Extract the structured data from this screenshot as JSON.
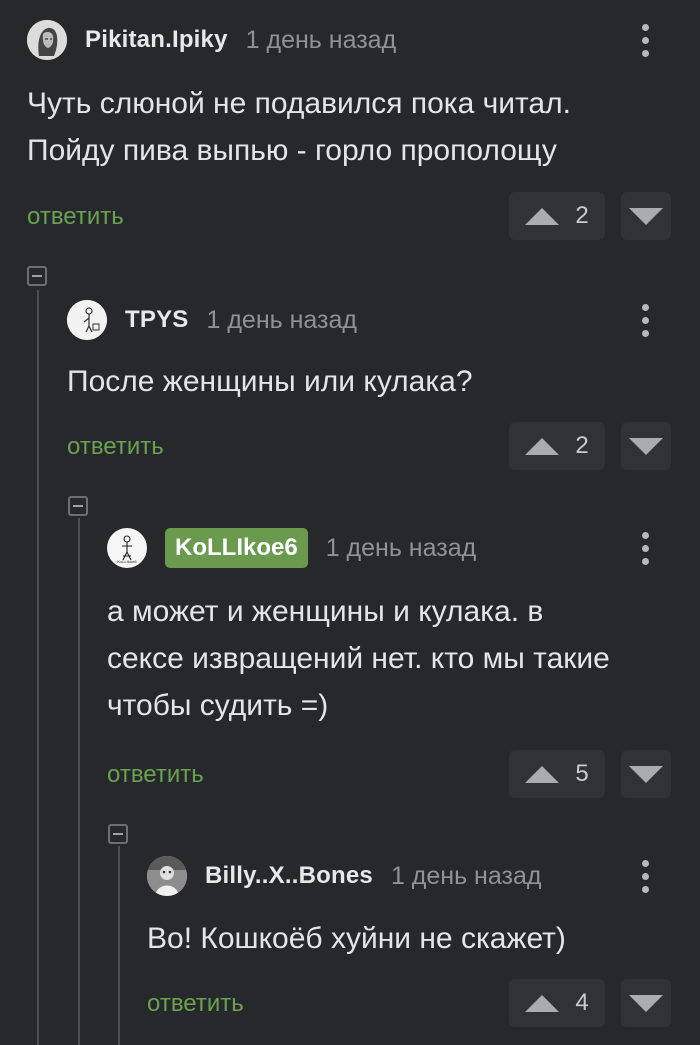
{
  "comments": [
    {
      "author": "Pikitan.Ipiky",
      "time": "1 день назад",
      "text": "Чуть слюной не подавился пока читал. Пойду пива выпью - горло прополощу",
      "reply_label": "ответить",
      "score": "2",
      "avatar_icon": "avatar-sketch-icon",
      "author_highlighted": false
    },
    {
      "author": "TPYS",
      "time": "1 день назад",
      "text": "После женщины или кулака?",
      "reply_label": "ответить",
      "score": "2",
      "avatar_icon": "avatar-doodle-icon",
      "author_highlighted": false
    },
    {
      "author": "KoLLIkoe6",
      "time": "1 день назад",
      "text": "а может и женщины и кулака. в сексе извращений нет. кто мы такие чтобы судить =)",
      "reply_label": "ответить",
      "score": "5",
      "avatar_icon": "avatar-figure-icon",
      "avatar_caption": "KoLLIkoe6",
      "author_highlighted": true
    },
    {
      "author": "Billy..X..Bones",
      "time": "1 день назад",
      "text": "Во! Кошкоёб хуйни не скажет)",
      "reply_label": "ответить",
      "score": "4",
      "avatar_icon": "avatar-photo-icon",
      "author_highlighted": false
    }
  ],
  "colors": {
    "background": "#26282b",
    "reply_link": "#6aa24f",
    "author_badge": "#6a9a4d",
    "vote_button": "#2f3237"
  }
}
